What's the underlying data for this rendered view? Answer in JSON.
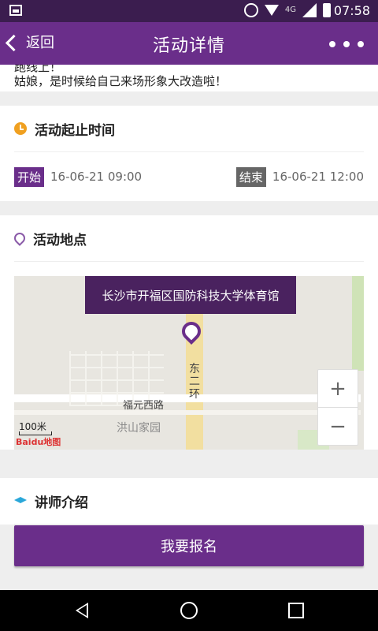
{
  "status_bar": {
    "time": "07:58",
    "network": "4G"
  },
  "app_bar": {
    "back_label": "返回",
    "title": "活动详情"
  },
  "intro": {
    "line1": "跑线上！",
    "line2": "姑娘，是时候给自己来场形象大改造啦！"
  },
  "sections": {
    "time": {
      "title": "活动起止时间",
      "start_badge": "开始",
      "start_time": "16-06-21 09:00",
      "end_badge": "结束",
      "end_time": "16-06-21 12:00"
    },
    "location": {
      "title": "活动地点",
      "address": "长沙市开福区国防科技大学体育馆",
      "map": {
        "road_label_vertical": "东二环",
        "road_label_horizontal": "福元西路",
        "place_label": "洪山家园",
        "scale": "100米",
        "provider": "Baidu地图",
        "zoom_in": "+",
        "zoom_out": "−"
      }
    },
    "lecturer": {
      "title": "讲师介绍"
    }
  },
  "actions": {
    "signup_label": "我要报名"
  },
  "colors": {
    "primary": "#6a2e8a",
    "status_bar": "#3b1d4f"
  },
  "icons": {
    "status": [
      "image-icon",
      "alarm-icon",
      "wifi-icon",
      "signal-icon",
      "battery-icon"
    ],
    "sections": [
      "clock-icon",
      "location-pin-icon",
      "graduation-cap-icon"
    ],
    "nav": [
      "nav-back-icon",
      "nav-home-icon",
      "nav-recent-icon"
    ]
  }
}
